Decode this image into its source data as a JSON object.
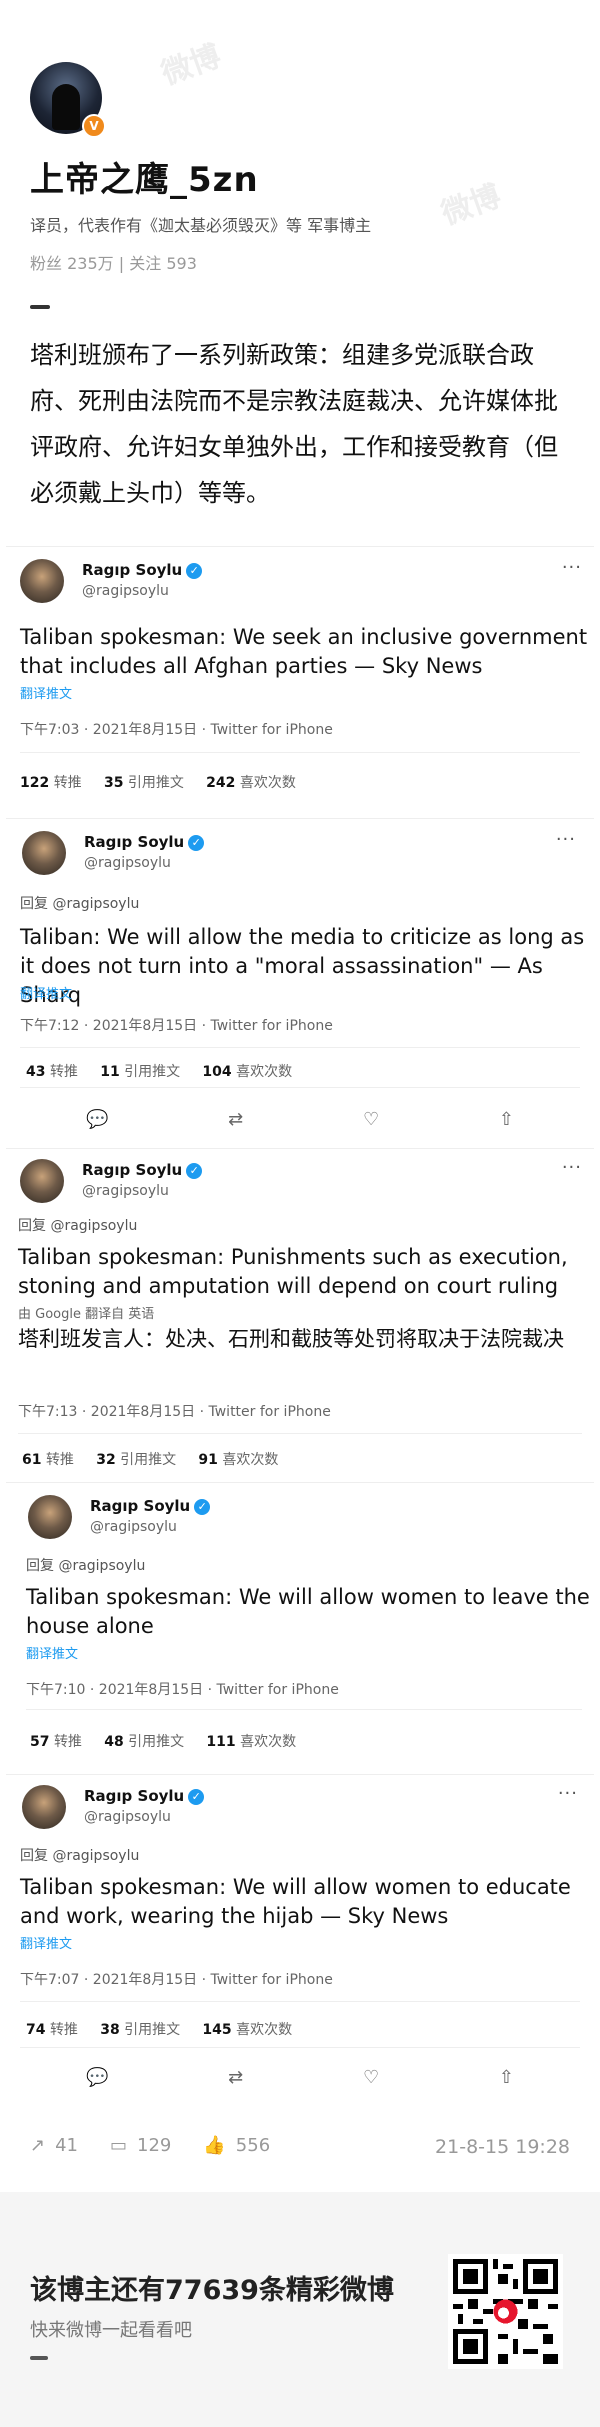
{
  "profile": {
    "username": "上帝之鹰_5zn",
    "verified_badge": "V",
    "bio": "译员，代表作有《迦太基必须毁灭》等 军事博主",
    "followers_label": "粉丝",
    "followers": "235万",
    "following_label": "关注",
    "following": "593"
  },
  "post": {
    "text": "塔利班颁布了一系列新政策：组建多党派联合政府、死刑由法院而不是宗教法庭裁决、允许媒体批评政府、允许妇女单独外出，工作和接受教育（但必须戴上头巾）等等。"
  },
  "tweets": [
    {
      "name": "Ragıp Soylu",
      "handle": "@ragipsoylu",
      "reply_to": "",
      "text": "Taliban spokesman: We seek an inclusive government that includes all Afghan parties — Sky News",
      "translate": "翻译推文",
      "meta": "下午7:03 · 2021年8月15日 · Twitter for iPhone",
      "retweets": "122",
      "retweets_label": "转推",
      "quotes": "35",
      "quotes_label": "引用推文",
      "likes": "242",
      "likes_label": "喜欢次数"
    },
    {
      "name": "Ragıp Soylu",
      "handle": "@ragipsoylu",
      "reply_to": "回复 @ragipsoylu",
      "text": "Taliban: We will allow the media to criticize as long as it does not turn into a \"moral assassination\" — As Sharq",
      "translate": "翻译推文",
      "meta": "下午7:12 · 2021年8月15日 · Twitter for iPhone",
      "retweets": "43",
      "retweets_label": "转推",
      "quotes": "11",
      "quotes_label": "引用推文",
      "likes": "104",
      "likes_label": "喜欢次数"
    },
    {
      "name": "Ragıp Soylu",
      "handle": "@ragipsoylu",
      "reply_to": "回复 @ragipsoylu",
      "text": "Taliban spokesman: Punishments such as execution, stoning and amputation will depend on court ruling",
      "google_line": "由 Google 翻译自 英语",
      "translation": "塔利班发言人：处决、石刑和截肢等处罚将取决于法院裁决",
      "meta": "下午7:13 · 2021年8月15日 · Twitter for iPhone",
      "retweets": "61",
      "retweets_label": "转推",
      "quotes": "32",
      "quotes_label": "引用推文",
      "likes": "91",
      "likes_label": "喜欢次数"
    },
    {
      "name": "Ragıp Soylu",
      "handle": "@ragipsoylu",
      "reply_to": "回复 @ragipsoylu",
      "text": "Taliban spokesman: We will allow women to leave the house alone",
      "translate": "翻译推文",
      "meta": "下午7:10 · 2021年8月15日 · Twitter for iPhone",
      "retweets": "57",
      "retweets_label": "转推",
      "quotes": "48",
      "quotes_label": "引用推文",
      "likes": "111",
      "likes_label": "喜欢次数"
    },
    {
      "name": "Ragıp Soylu",
      "handle": "@ragipsoylu",
      "reply_to": "回复 @ragipsoylu",
      "text": "Taliban spokesman: We will allow women to educate and work, wearing the hijab — Sky News",
      "translate": "翻译推文",
      "meta": "下午7:07 · 2021年8月15日 · Twitter for iPhone",
      "retweets": "74",
      "retweets_label": "转推",
      "quotes": "38",
      "quotes_label": "引用推文",
      "likes": "145",
      "likes_label": "喜欢次数"
    }
  ],
  "footer": {
    "reposts": "41",
    "comments": "129",
    "likes": "556",
    "timestamp": "21-8-15 19:28"
  },
  "banner": {
    "title": "该博主还有77639条精彩微博",
    "subtitle": "快来微博一起看看吧"
  },
  "colors": {
    "accent": "#1d9bf0",
    "verified_orange": "#f08a1c",
    "weibo_red": "#e6162d"
  }
}
